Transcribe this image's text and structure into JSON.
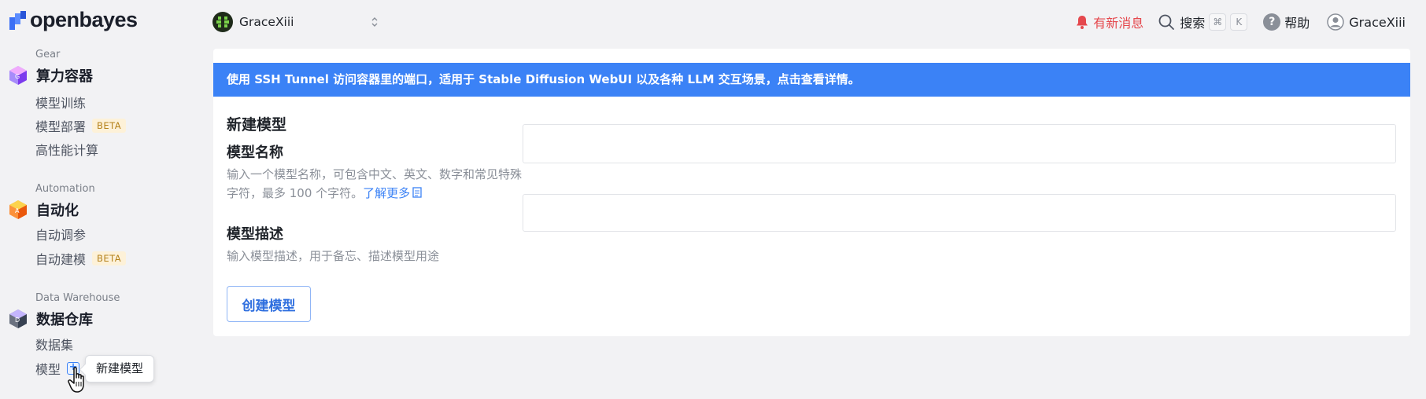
{
  "brand": {
    "name": "openbayes"
  },
  "sidebar": {
    "sections": [
      {
        "eyebrow": "Gear",
        "title": "算力容器",
        "items": [
          {
            "label": "模型训练"
          },
          {
            "label": "模型部署",
            "badge": "BETA"
          },
          {
            "label": "高性能计算"
          }
        ]
      },
      {
        "eyebrow": "Automation",
        "title": "自动化",
        "items": [
          {
            "label": "自动调参"
          },
          {
            "label": "自动建模",
            "badge": "BETA"
          }
        ]
      },
      {
        "eyebrow": "Data Warehouse",
        "title": "数据仓库",
        "items": [
          {
            "label": "数据集"
          },
          {
            "label": "模型",
            "action": "+"
          }
        ]
      }
    ],
    "tooltip": "新建模型"
  },
  "header": {
    "workspace": "GraceXiii",
    "notifications": "有新消息",
    "search": "搜索",
    "search_keys": [
      "⌘",
      "K"
    ],
    "help": "帮助",
    "user": "GraceXiii"
  },
  "main": {
    "banner": "使用 SSH Tunnel 访问容器里的端口，适用于 Stable Diffusion WebUI 以及各种 LLM 交互场景，点击查看详情。",
    "form_title": "新建模型",
    "fields": [
      {
        "label": "模型名称",
        "help": "输入一个模型名称，可包含中文、英文、数字和常见特殊字符，最多 100 个字符。",
        "link": "了解更多",
        "value": "",
        "placeholder": ""
      },
      {
        "label": "模型描述",
        "help": "输入模型描述，用于备忘、描述模型用途",
        "value": "",
        "placeholder": ""
      }
    ],
    "submit": "创建模型"
  },
  "colors": {
    "accent": "#3b82f6",
    "alert": "#e5484d",
    "beta_text": "#b5821c",
    "beta_bg": "#fdf1d8"
  }
}
